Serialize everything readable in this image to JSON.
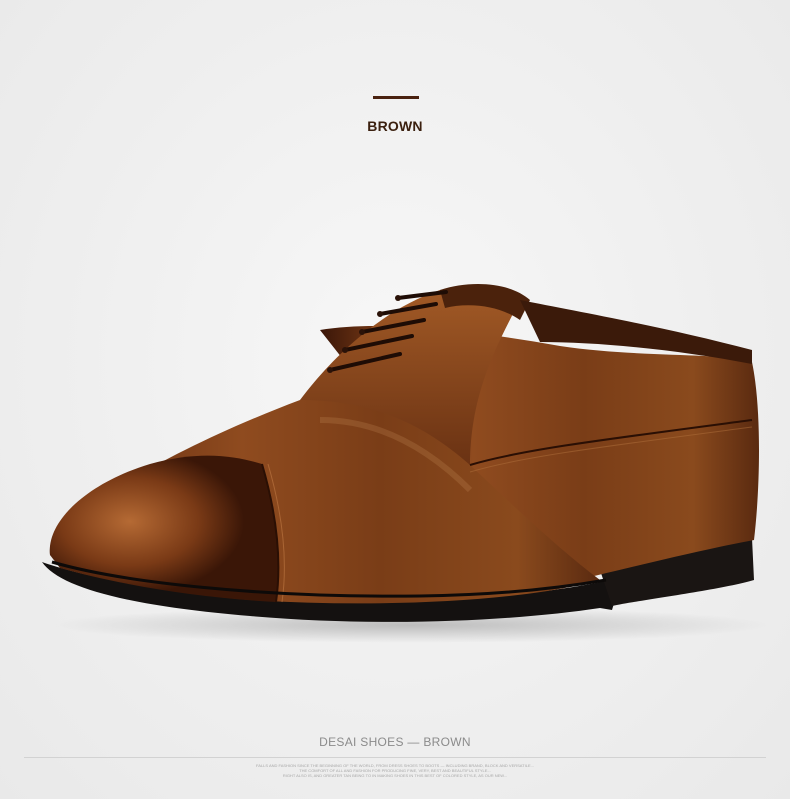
{
  "header": {
    "color_name": "BROWN",
    "accent_color": "#4a2210"
  },
  "product": {
    "image_label": "brown-cap-toe-oxford-shoe"
  },
  "footer": {
    "caption": "DESAI SHOES — BROWN",
    "fine_print": [
      "FALLS AND FASHION SINCE THE BEGINNING OF THE WORLD, FROM DRESS SHOES TO BOOTS — INCLUDING BRAND, BLOCK AND VERSATILE...",
      "THE COMFORT OF ALL AND FASHION FOR PRODUCING FINE, VERY, BEST AND BEAUTIFUL STYLE...",
      "RIGHT ALSO IS, AND GREATER TAN BEING TO IN MAKING SHOES IN THIS BEST OF COLORED STYLE, AS OUR NEW..."
    ]
  }
}
